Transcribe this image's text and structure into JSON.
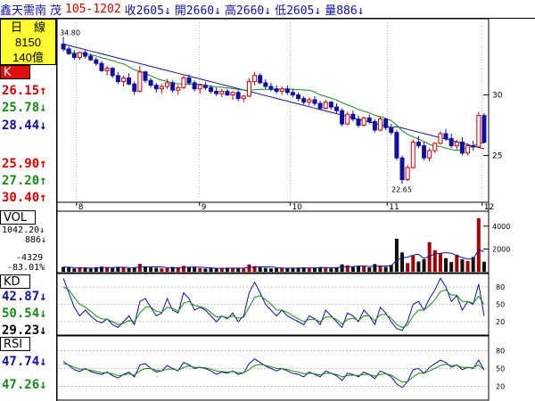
{
  "header": {
    "name": "鑫天需南",
    "code_label": "茂",
    "date_code": "105-1202",
    "close": "收2605↓",
    "open": "開2660↓",
    "high": "高2660↓",
    "low": "低2605↓",
    "volume": "量886↓"
  },
  "sidebar": {
    "period": "日　線",
    "num1": "8150",
    "num2": "140億",
    "k_tag": "K",
    "k_values": [
      "26.15↑",
      "25.78↓",
      "28.44↓"
    ],
    "k_values2": [
      "25.90↑",
      "27.20↑",
      "30.40↑"
    ],
    "vol_tag": "VOL",
    "vol_values": [
      "1042.20↓",
      "886↓",
      "-4329",
      "-83.01%"
    ],
    "kd_tag": "KD",
    "kd_values": [
      "42.87↓",
      "50.54↓",
      "29.23↓"
    ],
    "rsi_tag": "RSI",
    "rsi_values": [
      "47.74↓",
      "47.26↓"
    ]
  },
  "colors": {
    "up": "#d00000",
    "down": "#1010a0",
    "ma_short": "#1a8a1a",
    "ma_long": "#1010a0",
    "highlight": "#ffff33"
  },
  "chart_data": [
    {
      "type": "candlestick",
      "title": "",
      "x_ticks": [
        "8",
        "9",
        "10",
        "11",
        "12"
      ],
      "y_ticks": [
        30,
        25
      ],
      "annotations": [
        "34.80",
        "22.65"
      ],
      "ylim": [
        21.5,
        36
      ],
      "ohlc": [
        [
          34.2,
          34.8,
          33.6,
          33.8
        ],
        [
          33.8,
          34.0,
          33.3,
          33.4
        ],
        [
          33.4,
          33.7,
          32.9,
          33.1
        ],
        [
          33.1,
          33.6,
          32.9,
          33.5
        ],
        [
          33.5,
          33.7,
          33.0,
          33.2
        ],
        [
          33.2,
          33.4,
          32.8,
          32.9
        ],
        [
          32.9,
          33.1,
          32.4,
          32.6
        ],
        [
          32.6,
          32.8,
          31.9,
          32.0
        ],
        [
          32.0,
          32.4,
          31.6,
          32.2
        ],
        [
          32.2,
          32.3,
          31.4,
          31.6
        ],
        [
          31.6,
          31.9,
          30.9,
          31.1
        ],
        [
          31.1,
          31.6,
          30.7,
          31.4
        ],
        [
          31.4,
          31.8,
          30.8,
          30.9
        ],
        [
          30.9,
          31.1,
          30.0,
          30.3
        ],
        [
          30.3,
          32.4,
          30.2,
          31.9
        ],
        [
          31.9,
          32.0,
          31.0,
          31.2
        ],
        [
          31.2,
          31.4,
          30.6,
          30.8
        ],
        [
          30.8,
          31.0,
          30.2,
          30.5
        ],
        [
          30.5,
          30.9,
          30.1,
          30.7
        ],
        [
          30.7,
          31.3,
          30.5,
          31.0
        ],
        [
          31.0,
          31.2,
          30.2,
          30.4
        ],
        [
          30.4,
          30.8,
          30.0,
          30.6
        ],
        [
          30.6,
          31.6,
          30.5,
          31.4
        ],
        [
          31.4,
          31.7,
          30.8,
          31.0
        ],
        [
          31.0,
          31.2,
          30.3,
          30.5
        ],
        [
          30.5,
          30.9,
          30.1,
          30.8
        ],
        [
          30.8,
          31.1,
          30.4,
          30.6
        ],
        [
          30.6,
          30.8,
          30.1,
          30.3
        ],
        [
          30.3,
          30.6,
          29.9,
          30.1
        ],
        [
          30.1,
          30.5,
          29.8,
          30.3
        ],
        [
          30.3,
          30.5,
          29.9,
          30.0
        ],
        [
          30.0,
          30.3,
          29.6,
          30.2
        ],
        [
          30.2,
          30.4,
          29.5,
          29.7
        ],
        [
          29.7,
          30.0,
          29.4,
          29.9
        ],
        [
          29.9,
          31.4,
          29.8,
          31.1
        ],
        [
          31.1,
          31.9,
          30.8,
          31.6
        ],
        [
          31.6,
          31.8,
          30.9,
          31.0
        ],
        [
          31.0,
          31.3,
          30.5,
          30.7
        ],
        [
          30.7,
          31.0,
          30.3,
          30.5
        ],
        [
          30.5,
          30.8,
          30.1,
          30.3
        ],
        [
          30.3,
          30.7,
          30.0,
          30.5
        ],
        [
          30.5,
          30.8,
          30.0,
          30.2
        ],
        [
          30.2,
          30.5,
          29.8,
          30.0
        ],
        [
          30.0,
          30.2,
          29.5,
          29.7
        ],
        [
          29.7,
          29.9,
          29.2,
          29.4
        ],
        [
          29.4,
          29.8,
          29.1,
          29.6
        ],
        [
          29.6,
          29.9,
          29.1,
          29.3
        ],
        [
          29.3,
          29.5,
          28.7,
          28.9
        ],
        [
          28.9,
          29.6,
          28.8,
          29.4
        ],
        [
          29.4,
          29.5,
          28.8,
          29.0
        ],
        [
          29.0,
          29.3,
          28.5,
          28.7
        ],
        [
          28.7,
          28.9,
          27.4,
          27.6
        ],
        [
          27.6,
          28.6,
          27.5,
          28.4
        ],
        [
          28.4,
          28.7,
          27.8,
          28.0
        ],
        [
          28.0,
          28.3,
          27.3,
          27.5
        ],
        [
          27.5,
          28.2,
          27.4,
          28.1
        ],
        [
          28.1,
          28.4,
          27.6,
          27.8
        ],
        [
          27.8,
          28.0,
          26.9,
          27.1
        ],
        [
          27.1,
          28.2,
          27.0,
          28.0
        ],
        [
          28.0,
          28.1,
          27.1,
          27.3
        ],
        [
          27.3,
          27.6,
          26.7,
          26.9
        ],
        [
          26.9,
          27.1,
          24.6,
          24.8
        ],
        [
          24.8,
          25.0,
          22.65,
          23.0
        ],
        [
          23.0,
          24.2,
          22.9,
          24.0
        ],
        [
          24.0,
          26.3,
          23.9,
          26.1
        ],
        [
          26.1,
          26.6,
          25.6,
          25.8
        ],
        [
          25.8,
          26.1,
          24.6,
          24.8
        ],
        [
          24.8,
          25.6,
          24.5,
          25.4
        ],
        [
          25.4,
          26.1,
          25.2,
          26.0
        ],
        [
          26.0,
          27.0,
          25.9,
          26.8
        ],
        [
          26.8,
          27.2,
          26.2,
          26.4
        ],
        [
          26.4,
          26.8,
          25.6,
          25.8
        ],
        [
          25.8,
          26.3,
          25.5,
          26.1
        ],
        [
          26.1,
          26.5,
          25.0,
          25.2
        ],
        [
          25.2,
          26.0,
          25.0,
          25.8
        ],
        [
          25.8,
          26.2,
          25.4,
          25.7
        ],
        [
          25.7,
          28.6,
          25.6,
          28.3
        ],
        [
          28.3,
          28.5,
          26.0,
          26.1
        ]
      ]
    },
    {
      "type": "bar",
      "title": "VOL",
      "y_ticks": [
        4000,
        2000
      ],
      "ylim": [
        0,
        5000
      ],
      "values": [
        420,
        380,
        300,
        350,
        310,
        280,
        400,
        450,
        380,
        330,
        420,
        390,
        310,
        350,
        700,
        420,
        380,
        350,
        300,
        330,
        420,
        360,
        520,
        410,
        380,
        320,
        290,
        310,
        280,
        340,
        360,
        300,
        330,
        290,
        650,
        500,
        380,
        340,
        300,
        320,
        350,
        300,
        330,
        360,
        390,
        310,
        330,
        420,
        380,
        300,
        360,
        650,
        560,
        420,
        500,
        460,
        380,
        680,
        540,
        430,
        600,
        2900,
        1700,
        760,
        1400,
        900,
        1100,
        2600,
        1900,
        1600,
        1200,
        850,
        1500,
        1100,
        950,
        1300,
        4700,
        886
      ],
      "up_flags": [
        0,
        0,
        0,
        1,
        0,
        0,
        0,
        0,
        1,
        0,
        0,
        1,
        0,
        0,
        1,
        0,
        0,
        0,
        1,
        1,
        0,
        1,
        1,
        0,
        0,
        1,
        0,
        0,
        0,
        1,
        0,
        1,
        0,
        1,
        1,
        1,
        0,
        0,
        0,
        0,
        1,
        0,
        0,
        0,
        0,
        1,
        0,
        0,
        1,
        0,
        0,
        0,
        1,
        0,
        0,
        1,
        0,
        0,
        1,
        0,
        0,
        0,
        0,
        1,
        1,
        0,
        0,
        1,
        1,
        1,
        0,
        0,
        1,
        0,
        1,
        0,
        1,
        0
      ]
    },
    {
      "type": "line",
      "title": "KD",
      "y_ticks": [
        80,
        50,
        20
      ],
      "ylim": [
        0,
        100
      ],
      "series": [
        {
          "values": [
            95,
            70,
            45,
            30,
            40,
            30,
            22,
            18,
            25,
            15,
            10,
            20,
            30,
            15,
            55,
            60,
            45,
            30,
            35,
            60,
            40,
            35,
            70,
            60,
            40,
            45,
            40,
            30,
            20,
            30,
            25,
            35,
            20,
            30,
            70,
            88,
            70,
            50,
            40,
            30,
            40,
            30,
            25,
            20,
            15,
            30,
            25,
            15,
            40,
            30,
            20,
            10,
            35,
            30,
            20,
            40,
            30,
            15,
            45,
            35,
            20,
            8,
            5,
            20,
            50,
            55,
            40,
            60,
            75,
            95,
            80,
            55,
            65,
            40,
            55,
            50,
            85,
            30
          ]
        },
        {
          "values": [
            80,
            75,
            62,
            50,
            45,
            38,
            30,
            25,
            24,
            20,
            15,
            17,
            22,
            20,
            35,
            45,
            45,
            38,
            36,
            45,
            43,
            38,
            52,
            55,
            48,
            46,
            43,
            36,
            28,
            29,
            27,
            30,
            26,
            28,
            45,
            62,
            65,
            58,
            50,
            40,
            40,
            36,
            30,
            25,
            20,
            24,
            24,
            20,
            28,
            28,
            24,
            16,
            24,
            26,
            22,
            30,
            30,
            22,
            32,
            33,
            26,
            15,
            10,
            14,
            30,
            40,
            40,
            48,
            58,
            72,
            75,
            66,
            66,
            55,
            55,
            52,
            64,
            50
          ]
        }
      ]
    },
    {
      "type": "line",
      "title": "RSI",
      "y_ticks": [
        80,
        50,
        20
      ],
      "ylim": [
        0,
        100
      ],
      "series": [
        {
          "values": [
            62,
            55,
            48,
            45,
            50,
            45,
            42,
            40,
            44,
            38,
            34,
            40,
            44,
            36,
            56,
            58,
            50,
            44,
            46,
            55,
            50,
            46,
            60,
            56,
            50,
            52,
            50,
            46,
            40,
            44,
            42,
            46,
            40,
            43,
            58,
            66,
            60,
            54,
            50,
            46,
            50,
            46,
            42,
            40,
            36,
            44,
            40,
            36,
            46,
            42,
            38,
            30,
            42,
            40,
            36,
            44,
            40,
            33,
            46,
            42,
            36,
            24,
            18,
            28,
            48,
            50,
            42,
            52,
            58,
            64,
            60,
            52,
            56,
            48,
            52,
            50,
            64,
            47.74
          ]
        },
        {
          "values": [
            58,
            56,
            52,
            49,
            49,
            47,
            45,
            43,
            43,
            41,
            38,
            39,
            41,
            39,
            46,
            50,
            50,
            47,
            46,
            49,
            49,
            47,
            52,
            54,
            52,
            52,
            51,
            49,
            46,
            45,
            44,
            45,
            43,
            43,
            48,
            55,
            57,
            55,
            53,
            50,
            50,
            48,
            46,
            44,
            41,
            42,
            41,
            39,
            42,
            42,
            40,
            36,
            38,
            39,
            38,
            40,
            40,
            37,
            40,
            41,
            39,
            33,
            27,
            28,
            36,
            42,
            42,
            46,
            50,
            55,
            57,
            55,
            55,
            52,
            52,
            51,
            56,
            47.26
          ]
        }
      ]
    }
  ]
}
